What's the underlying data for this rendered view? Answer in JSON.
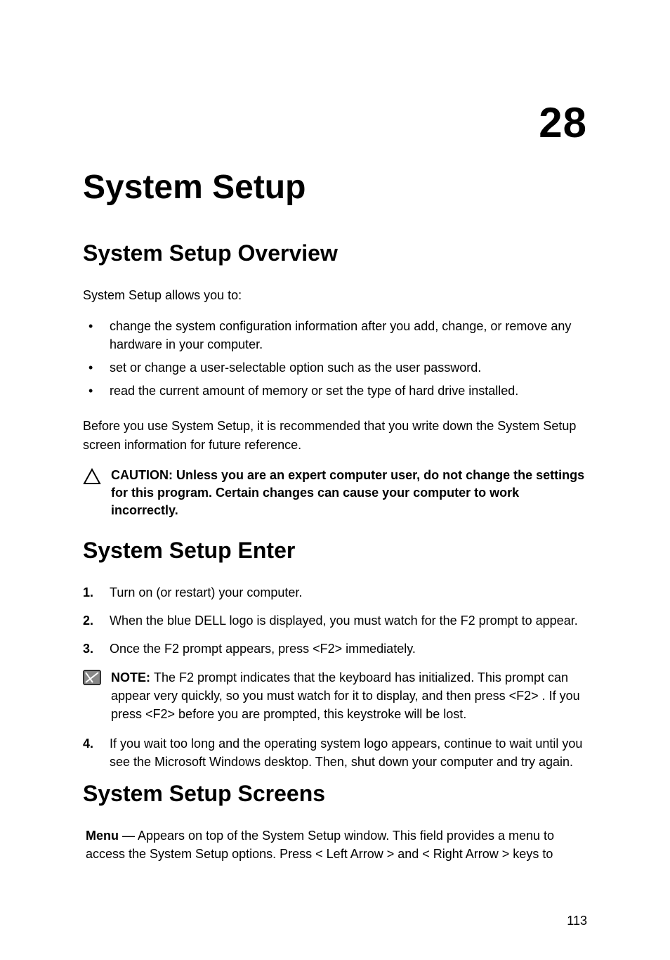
{
  "chapter": {
    "number": "28",
    "title": "System Setup"
  },
  "sections": {
    "overview": {
      "title": "System Setup Overview",
      "intro": "System Setup allows you to:",
      "bullets": [
        "change the system configuration information after you add, change, or remove any hardware in your computer.",
        "set or change a user-selectable option such as the user password.",
        "read the current amount of memory or set the type of hard drive installed."
      ],
      "recommendation": "Before you use System Setup, it is recommended that you write down the System Setup screen information for future reference.",
      "caution_label": "CAUTION: ",
      "caution_text": "Unless you are an expert computer user, do not change the settings for this program. Certain changes can cause your computer to work incorrectly."
    },
    "enter": {
      "title": "System Setup Enter",
      "steps": {
        "1": "Turn on (or restart) your computer.",
        "2": "When the blue DELL logo is displayed, you must watch for the F2 prompt to appear.",
        "3": "Once the F2 prompt appears, press <F2> immediately.",
        "4": "If you wait too long and the operating system logo appears, continue to wait until you see the Microsoft Windows desktop. Then, shut down your computer and try again."
      },
      "note_label": "NOTE: ",
      "note_text": "The F2 prompt indicates that the keyboard has initialized. This prompt can appear very quickly, so you must watch for it to display, and then press <F2> . If you press <F2> before you are prompted, this keystroke will be lost."
    },
    "screens": {
      "title": "System Setup Screens",
      "menu_label": "Menu",
      "menu_text": " — Appears on top of the System Setup window. This field provides a menu to access the System Setup options. Press < Left Arrow > and < Right Arrow > keys to"
    }
  },
  "page_number": "113"
}
